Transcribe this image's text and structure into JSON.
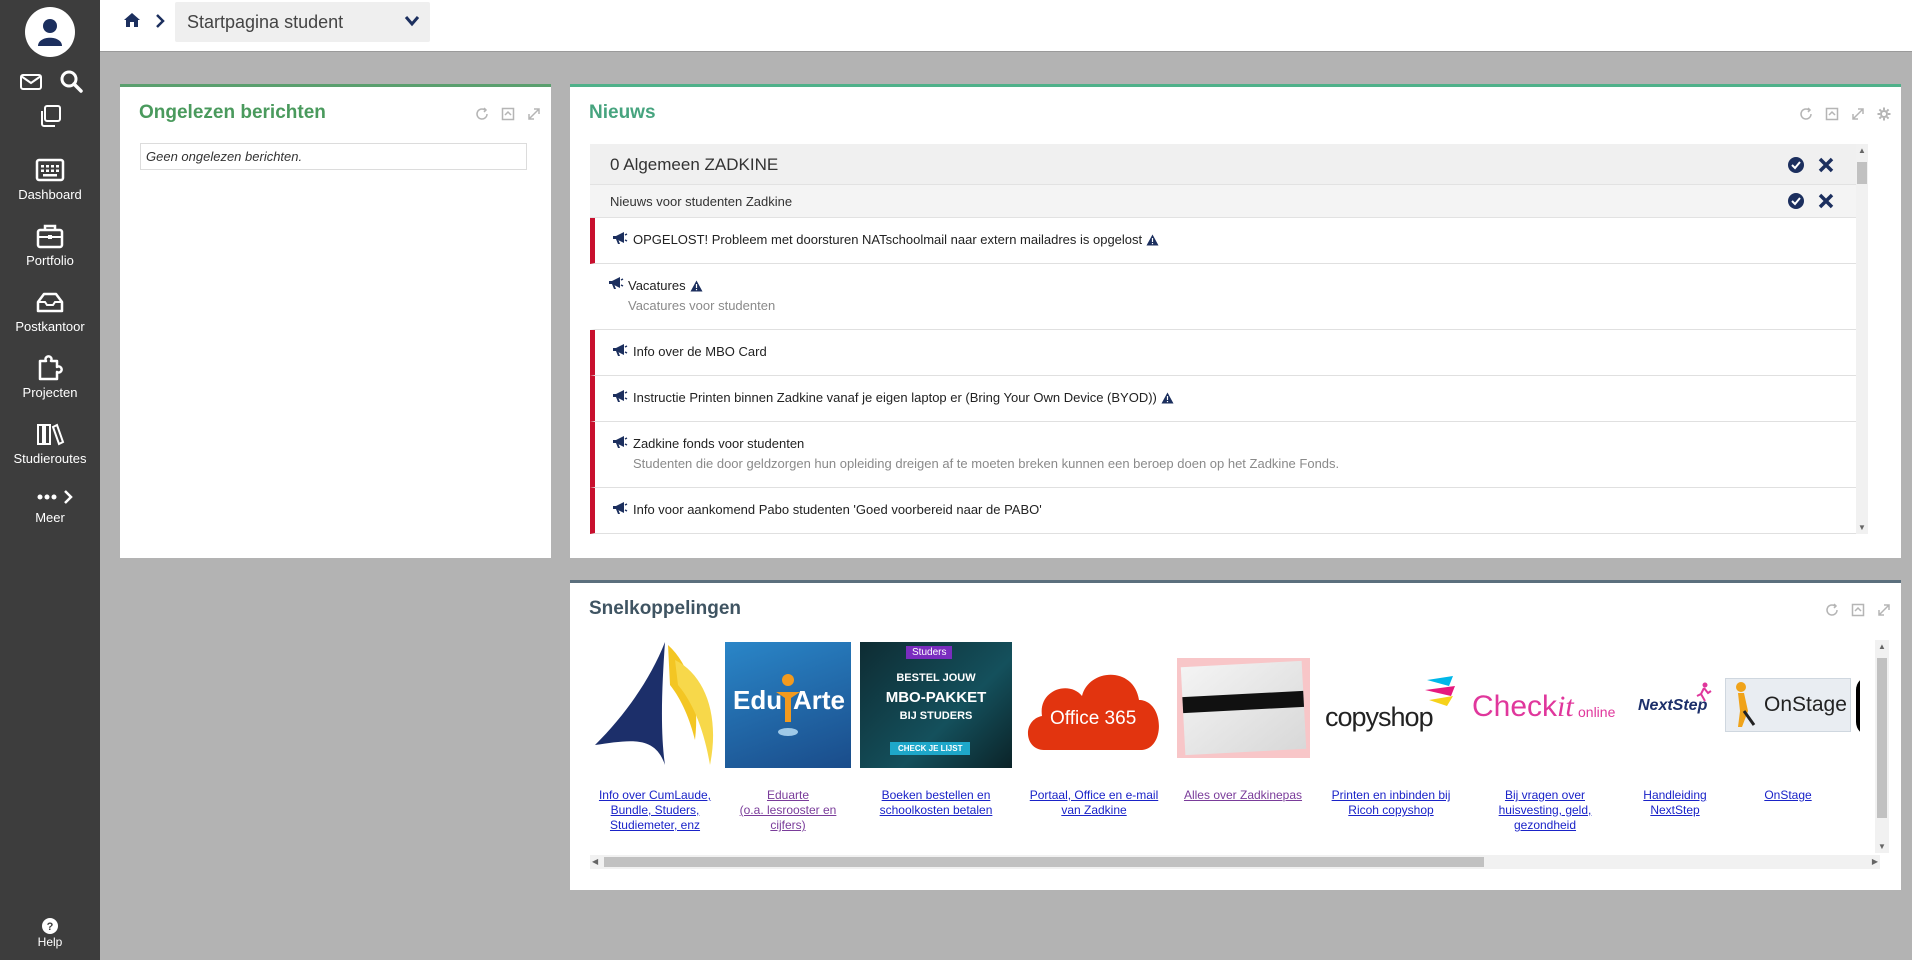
{
  "sidebar": {
    "items": [
      {
        "label": "Dashboard",
        "icon": "dashboard-icon"
      },
      {
        "label": "Portfolio",
        "icon": "briefcase-icon"
      },
      {
        "label": "Postkantoor",
        "icon": "inbox-icon"
      },
      {
        "label": "Projecten",
        "icon": "puzzle-icon"
      },
      {
        "label": "Studieroutes",
        "icon": "books-icon"
      },
      {
        "label": "Meer",
        "icon": "more-icon"
      }
    ],
    "help_label": "Help"
  },
  "topbar": {
    "page_select": "Startpagina student"
  },
  "berichten": {
    "title": "Ongelezen berichten",
    "empty": "Geen ongelezen berichten."
  },
  "nieuws": {
    "title": "Nieuws",
    "group_header": "0 Algemeen ZADKINE",
    "sub_header": "Nieuws voor studenten Zadkine",
    "items": [
      {
        "title": "OPGELOST! Probleem met doorsturen NATschoolmail naar extern mailadres is opgelost",
        "subtitle": "",
        "flagged": true,
        "warning": true
      },
      {
        "title": "Vacatures",
        "subtitle": "Vacatures voor studenten",
        "flagged": false,
        "warning": true
      },
      {
        "title": "Info over de MBO Card",
        "subtitle": "",
        "flagged": true,
        "warning": false
      },
      {
        "title": "Instructie Printen binnen Zadkine vanaf je eigen laptop er (Bring Your Own Device (BYOD))",
        "subtitle": "",
        "flagged": true,
        "warning": true
      },
      {
        "title": "Zadkine fonds voor studenten",
        "subtitle": "Studenten die door geldzorgen hun opleiding dreigen af te moeten breken kunnen een beroep doen op het Zadkine Fonds.",
        "flagged": true,
        "warning": false
      },
      {
        "title": "Info voor aankomend Pabo studenten 'Goed voorbereid naar de PABO'",
        "subtitle": "",
        "flagged": true,
        "warning": false
      }
    ]
  },
  "snel": {
    "title": "Snelkoppelingen",
    "links": [
      {
        "caption_lines": [
          "Info over CumLaude,",
          "Bundle, Studers,",
          "Studiemeter, enz"
        ]
      },
      {
        "caption_lines": [
          "Eduarte",
          "(o.a. lesrooster en",
          "cijfers)"
        ],
        "logo": [
          "Edu",
          "Arte"
        ]
      },
      {
        "caption_lines": [
          "Boeken bestellen en",
          "schoolkosten betalen"
        ],
        "logo": [
          "Studers",
          "BESTEL JOUW",
          "MBO-PAKKET",
          "BIJ STUDERS",
          "CHECK JE LIJST"
        ]
      },
      {
        "caption_lines": [
          "Portaal, Office en e-mail",
          "van Zadkine"
        ],
        "logo": [
          "Office 365"
        ]
      },
      {
        "caption_lines": [
          "Alles over Zadkinepas"
        ]
      },
      {
        "caption_lines": [
          "Printen en inbinden bij",
          "Ricoh copyshop"
        ],
        "logo": [
          "copyshop"
        ]
      },
      {
        "caption_lines": [
          "Bij vragen over",
          "huisvesting, geld,",
          "gezondheid"
        ],
        "logo": [
          "Check",
          "it",
          "online"
        ]
      },
      {
        "caption_lines": [
          "Handleiding",
          "NextStep"
        ],
        "logo": [
          "NextStep"
        ]
      },
      {
        "caption_lines": [
          "OnStage"
        ],
        "logo": [
          "OnStage"
        ]
      }
    ]
  },
  "colors": {
    "sidebar": "#3d3d3d",
    "flag": "#c8102e",
    "navy": "#1c2f5e",
    "link": "#1a23c8"
  }
}
